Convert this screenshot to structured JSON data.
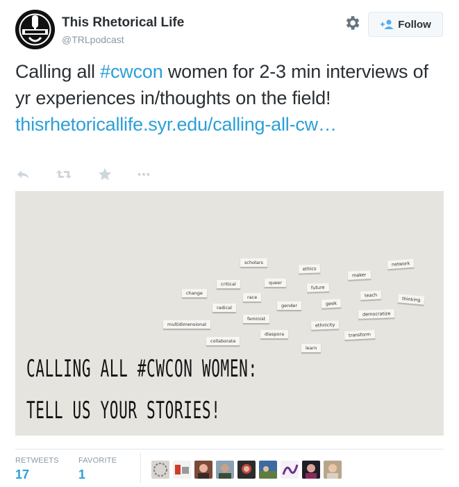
{
  "account": {
    "name": "This Rhetorical Life",
    "handle": "@TRLpodcast",
    "follow_label": "Follow"
  },
  "tweet": {
    "text_before": "Calling all ",
    "hashtag": "#cwcon",
    "text_middle": " women for 2-3 min interviews of yr experiences in/thoughts on the field!  ",
    "link": "thisrhetoricallife.syr.edu/calling-all-cw…"
  },
  "actions": {
    "icons": [
      "reply-icon",
      "retweet-icon",
      "favorite-icon",
      "more-icon"
    ]
  },
  "media": {
    "magnets": [
      "scholars",
      "ethics",
      "maker",
      "network",
      "critical",
      "queer",
      "future",
      "change",
      "race",
      "teach",
      "thinking",
      "radical",
      "gender",
      "geek",
      "democratize",
      "feminist",
      "multidimensional",
      "ethnicity",
      "diaspora",
      "transform",
      "collaborate",
      "learn"
    ],
    "line1": "CALLING ALL #CWCON WOMEN:",
    "line2": "TELL US YOUR STORIES!"
  },
  "stats": {
    "retweets_label": "RETWEETS",
    "retweets_value": "17",
    "favorites_label": "FAVORITE",
    "favorites_value": "1"
  },
  "colors": {
    "link": "#2b9fd8",
    "text": "#292f33",
    "muted": "#8899a6"
  }
}
